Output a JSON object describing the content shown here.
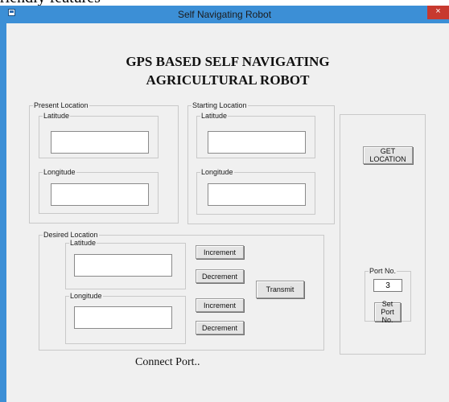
{
  "doc_text_fragment": "riendly features",
  "window": {
    "title": "Self Navigating Robot",
    "close_label": "×"
  },
  "heading": {
    "line1": "GPS BASED SELF NAVIGATING",
    "line2": "AGRICULTURAL ROBOT"
  },
  "present_location": {
    "legend": "Present Location",
    "latitude_label": "Latitude",
    "latitude_value": "",
    "longitude_label": "Longitude",
    "longitude_value": ""
  },
  "starting_location": {
    "legend": "Starting Location",
    "latitude_label": "Latitude",
    "latitude_value": "",
    "longitude_label": "Longitude",
    "longitude_value": ""
  },
  "desired_location": {
    "legend": "Desired Location",
    "latitude_label": "Latitude",
    "latitude_value": "",
    "longitude_label": "Longitude",
    "longitude_value": "",
    "lat_increment": "Increment",
    "lat_decrement": "Decrement",
    "lon_increment": "Increment",
    "lon_decrement": "Decrement",
    "transmit": "Transmit"
  },
  "right_panel": {
    "get_location": "GET LOCATION",
    "port_legend": "Port No.",
    "port_value": "3",
    "set_port_line1": "Set Port",
    "set_port_line2": "No."
  },
  "status": "Connect Port.."
}
